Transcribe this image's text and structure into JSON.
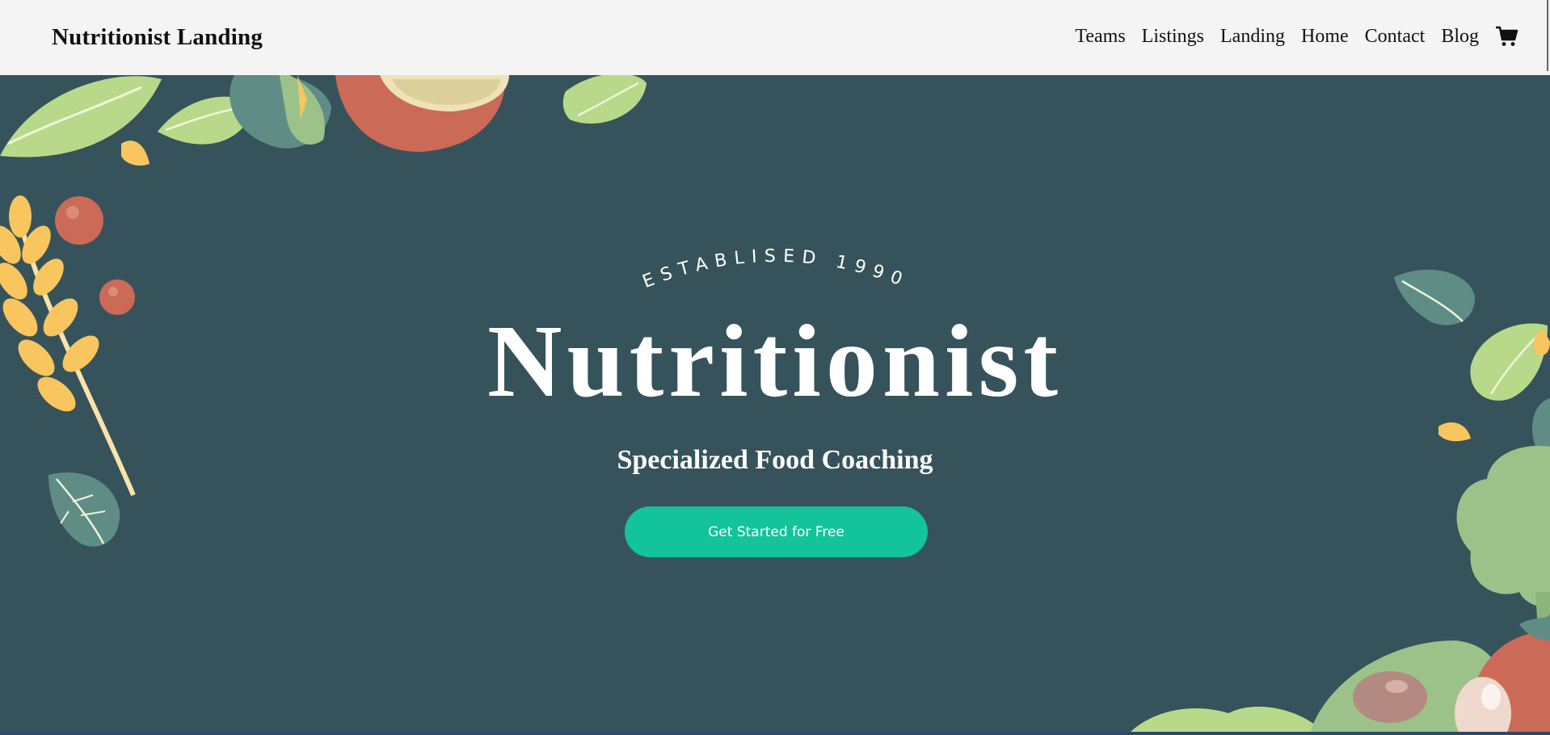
{
  "nav": {
    "brand": "Nutritionist Landing",
    "items": [
      {
        "label": "Teams"
      },
      {
        "label": "Listings"
      },
      {
        "label": "Landing"
      },
      {
        "label": "Home"
      },
      {
        "label": "Contact"
      },
      {
        "label": "Blog"
      }
    ],
    "cart_icon": "shopping-cart-icon"
  },
  "hero": {
    "eyebrow": "ESTABLISED 1990",
    "title": "Nutritionist",
    "subtitle": "Specialized Food Coaching",
    "cta_label": "Get Started for Free"
  },
  "colors": {
    "nav_bg": "#f4f4f4",
    "hero_bg": "#36535b",
    "accent": "#13c39a",
    "leaf_green": "#b8d98a",
    "leaf_teal": "#5f8d86",
    "tomato": "#cc6a58",
    "wheat": "#f8c55e"
  }
}
